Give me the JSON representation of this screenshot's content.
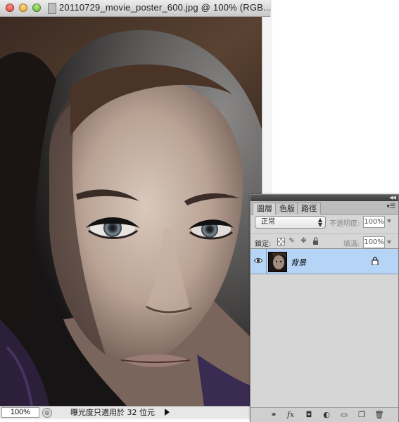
{
  "document": {
    "title": "20110729_movie_poster_600.jpg @ 100% (RGB...",
    "zoom": "100%",
    "status_info": "曝光度只適用於 32 位元"
  },
  "layers_panel": {
    "tabs": [
      "圖層",
      "色版",
      "路徑"
    ],
    "active_tab": "圖層",
    "blend_mode": "正常",
    "opacity_label": "不透明度:",
    "opacity_value": "100%",
    "lock_label": "鎖定:",
    "fill_label": "填滿:",
    "fill_value": "100%",
    "layers": [
      {
        "name": "背景",
        "visible": true,
        "locked": true,
        "selected": true
      }
    ],
    "bottom_icons": [
      "link-icon",
      "fx-icon",
      "mask-icon",
      "adjustment-icon",
      "group-folder-icon",
      "new-layer-icon",
      "trash-icon"
    ]
  },
  "colors": {
    "selected_layer": "#b6d4f6",
    "panel_bg": "#d6d6d6"
  }
}
